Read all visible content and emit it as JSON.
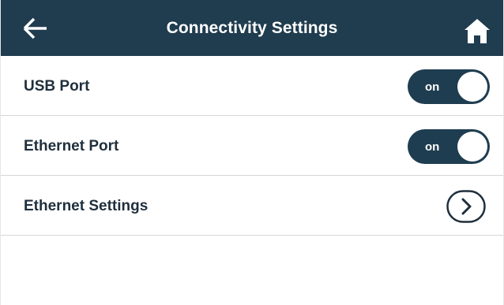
{
  "header": {
    "title": "Connectivity Settings",
    "back_icon": "arrow-left-icon",
    "home_icon": "home-icon",
    "background": "#203c4f"
  },
  "settings": [
    {
      "label": "USB Port",
      "control": "toggle",
      "state": "on"
    },
    {
      "label": "Ethernet Port",
      "control": "toggle",
      "state": "on"
    },
    {
      "label": "Ethernet Settings",
      "control": "chevron",
      "icon": "chevron-right-icon"
    }
  ],
  "colors": {
    "accent": "#1f3d50",
    "text": "#1f2f3c",
    "divider": "#d3d6d8"
  }
}
